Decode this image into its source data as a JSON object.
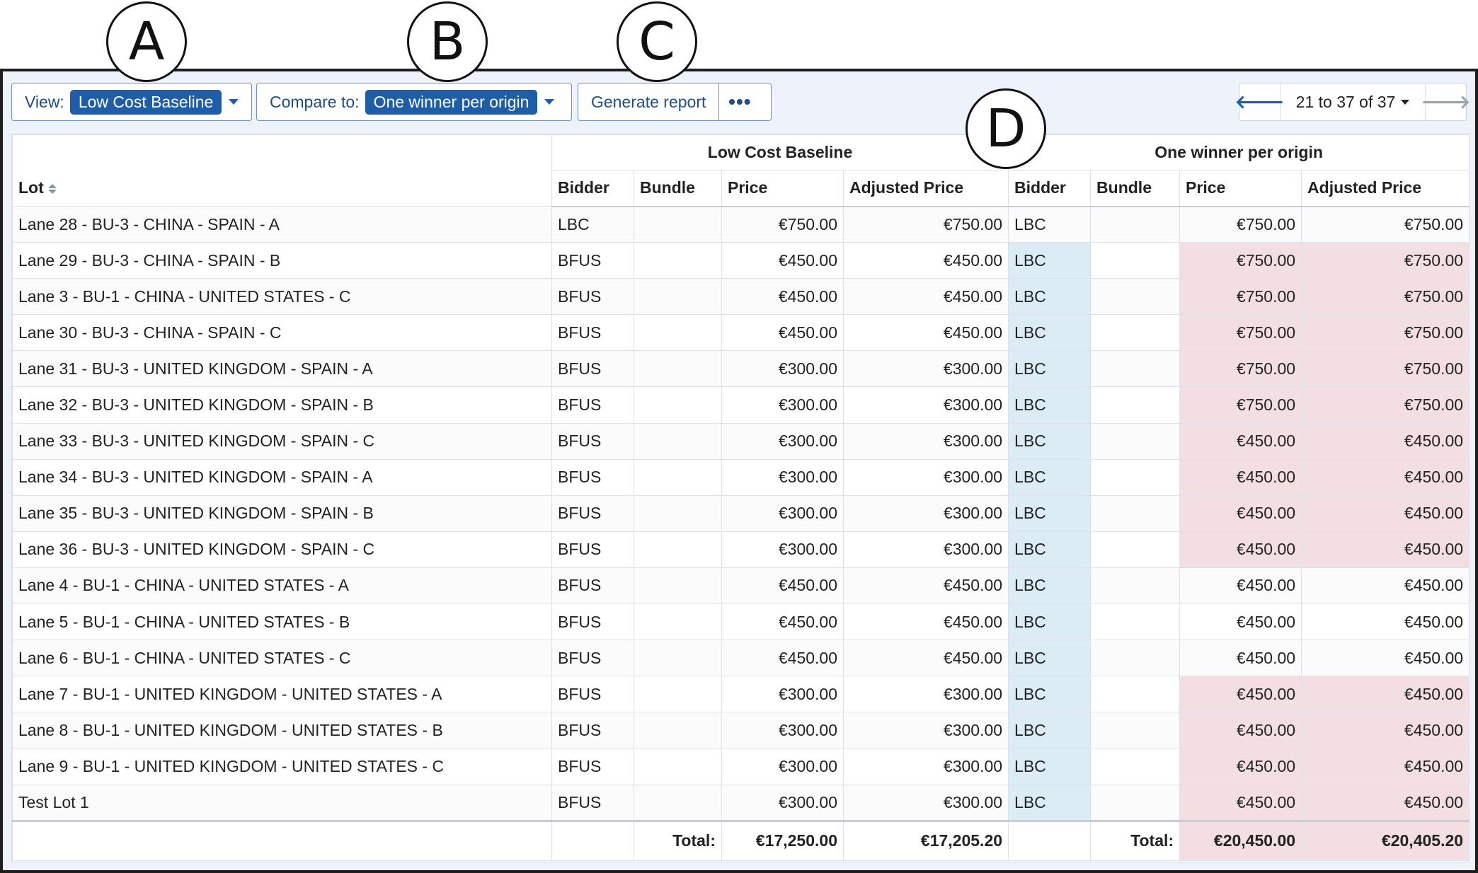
{
  "callouts": [
    "A",
    "B",
    "C",
    "D"
  ],
  "toolbar": {
    "view_label": "View:",
    "view_value": "Low Cost Baseline",
    "compare_label": "Compare to:",
    "compare_value": "One winner per origin",
    "generate_label": "Generate report",
    "more_label": "•••"
  },
  "pager": {
    "text": "21 to 37 of 37",
    "prev": "🡐",
    "next": "🡒"
  },
  "table": {
    "lot_header": "Lot",
    "group1": "Low Cost Baseline",
    "group2": "One winner per origin",
    "col_bidder": "Bidder",
    "col_bundle": "Bundle",
    "col_price": "Price",
    "col_adjusted": "Adjusted Price",
    "rows": [
      {
        "lot": "Lane 28 - BU-3 - CHINA - SPAIN - A",
        "b1": "LBC",
        "p1": "€750.00",
        "a1": "€750.00",
        "b2": "LBC",
        "p2": "€750.00",
        "a2": "€750.00",
        "diff_bidder": false,
        "diff_price": false
      },
      {
        "lot": "Lane 29 - BU-3 - CHINA - SPAIN - B",
        "b1": "BFUS",
        "p1": "€450.00",
        "a1": "€450.00",
        "b2": "LBC",
        "p2": "€750.00",
        "a2": "€750.00",
        "diff_bidder": true,
        "diff_price": true
      },
      {
        "lot": "Lane 3 - BU-1 - CHINA - UNITED STATES - C",
        "b1": "BFUS",
        "p1": "€450.00",
        "a1": "€450.00",
        "b2": "LBC",
        "p2": "€750.00",
        "a2": "€750.00",
        "diff_bidder": true,
        "diff_price": true
      },
      {
        "lot": "Lane 30 - BU-3 - CHINA - SPAIN - C",
        "b1": "BFUS",
        "p1": "€450.00",
        "a1": "€450.00",
        "b2": "LBC",
        "p2": "€750.00",
        "a2": "€750.00",
        "diff_bidder": true,
        "diff_price": true
      },
      {
        "lot": "Lane 31 - BU-3 - UNITED KINGDOM - SPAIN - A",
        "b1": "BFUS",
        "p1": "€300.00",
        "a1": "€300.00",
        "b2": "LBC",
        "p2": "€750.00",
        "a2": "€750.00",
        "diff_bidder": true,
        "diff_price": true
      },
      {
        "lot": "Lane 32 - BU-3 - UNITED KINGDOM - SPAIN - B",
        "b1": "BFUS",
        "p1": "€300.00",
        "a1": "€300.00",
        "b2": "LBC",
        "p2": "€750.00",
        "a2": "€750.00",
        "diff_bidder": true,
        "diff_price": true
      },
      {
        "lot": "Lane 33 - BU-3 - UNITED KINGDOM - SPAIN - C",
        "b1": "BFUS",
        "p1": "€300.00",
        "a1": "€300.00",
        "b2": "LBC",
        "p2": "€450.00",
        "a2": "€450.00",
        "diff_bidder": true,
        "diff_price": true
      },
      {
        "lot": "Lane 34 - BU-3 - UNITED KINGDOM - SPAIN - A",
        "b1": "BFUS",
        "p1": "€300.00",
        "a1": "€300.00",
        "b2": "LBC",
        "p2": "€450.00",
        "a2": "€450.00",
        "diff_bidder": true,
        "diff_price": true
      },
      {
        "lot": "Lane 35 - BU-3 - UNITED KINGDOM - SPAIN - B",
        "b1": "BFUS",
        "p1": "€300.00",
        "a1": "€300.00",
        "b2": "LBC",
        "p2": "€450.00",
        "a2": "€450.00",
        "diff_bidder": true,
        "diff_price": true
      },
      {
        "lot": "Lane 36 - BU-3 - UNITED KINGDOM - SPAIN - C",
        "b1": "BFUS",
        "p1": "€300.00",
        "a1": "€300.00",
        "b2": "LBC",
        "p2": "€450.00",
        "a2": "€450.00",
        "diff_bidder": true,
        "diff_price": true
      },
      {
        "lot": "Lane 4 - BU-1 - CHINA - UNITED STATES - A",
        "b1": "BFUS",
        "p1": "€450.00",
        "a1": "€450.00",
        "b2": "LBC",
        "p2": "€450.00",
        "a2": "€450.00",
        "diff_bidder": true,
        "diff_price": false
      },
      {
        "lot": "Lane 5 - BU-1 - CHINA - UNITED STATES - B",
        "b1": "BFUS",
        "p1": "€450.00",
        "a1": "€450.00",
        "b2": "LBC",
        "p2": "€450.00",
        "a2": "€450.00",
        "diff_bidder": true,
        "diff_price": false
      },
      {
        "lot": "Lane 6 - BU-1 - CHINA - UNITED STATES - C",
        "b1": "BFUS",
        "p1": "€450.00",
        "a1": "€450.00",
        "b2": "LBC",
        "p2": "€450.00",
        "a2": "€450.00",
        "diff_bidder": true,
        "diff_price": false
      },
      {
        "lot": "Lane 7 - BU-1 - UNITED KINGDOM - UNITED STATES - A",
        "b1": "BFUS",
        "p1": "€300.00",
        "a1": "€300.00",
        "b2": "LBC",
        "p2": "€450.00",
        "a2": "€450.00",
        "diff_bidder": true,
        "diff_price": true
      },
      {
        "lot": "Lane 8 - BU-1 - UNITED KINGDOM - UNITED STATES - B",
        "b1": "BFUS",
        "p1": "€300.00",
        "a1": "€300.00",
        "b2": "LBC",
        "p2": "€450.00",
        "a2": "€450.00",
        "diff_bidder": true,
        "diff_price": true
      },
      {
        "lot": "Lane 9 - BU-1 - UNITED KINGDOM - UNITED STATES - C",
        "b1": "BFUS",
        "p1": "€300.00",
        "a1": "€300.00",
        "b2": "LBC",
        "p2": "€450.00",
        "a2": "€450.00",
        "diff_bidder": true,
        "diff_price": true
      },
      {
        "lot": "Test Lot 1",
        "b1": "BFUS",
        "p1": "€300.00",
        "a1": "€300.00",
        "b2": "LBC",
        "p2": "€450.00",
        "a2": "€450.00",
        "diff_bidder": true,
        "diff_price": true
      }
    ],
    "footer": {
      "total_label": "Total:",
      "p1_total": "€17,250.00",
      "a1_total": "€17,205.20",
      "p2_total": "€20,450.00",
      "a2_total": "€20,405.20"
    }
  },
  "colors": {
    "accent": "#1f5da6",
    "bidder_diff": "#dcecf4",
    "price_diff": "#f3dfe1"
  }
}
